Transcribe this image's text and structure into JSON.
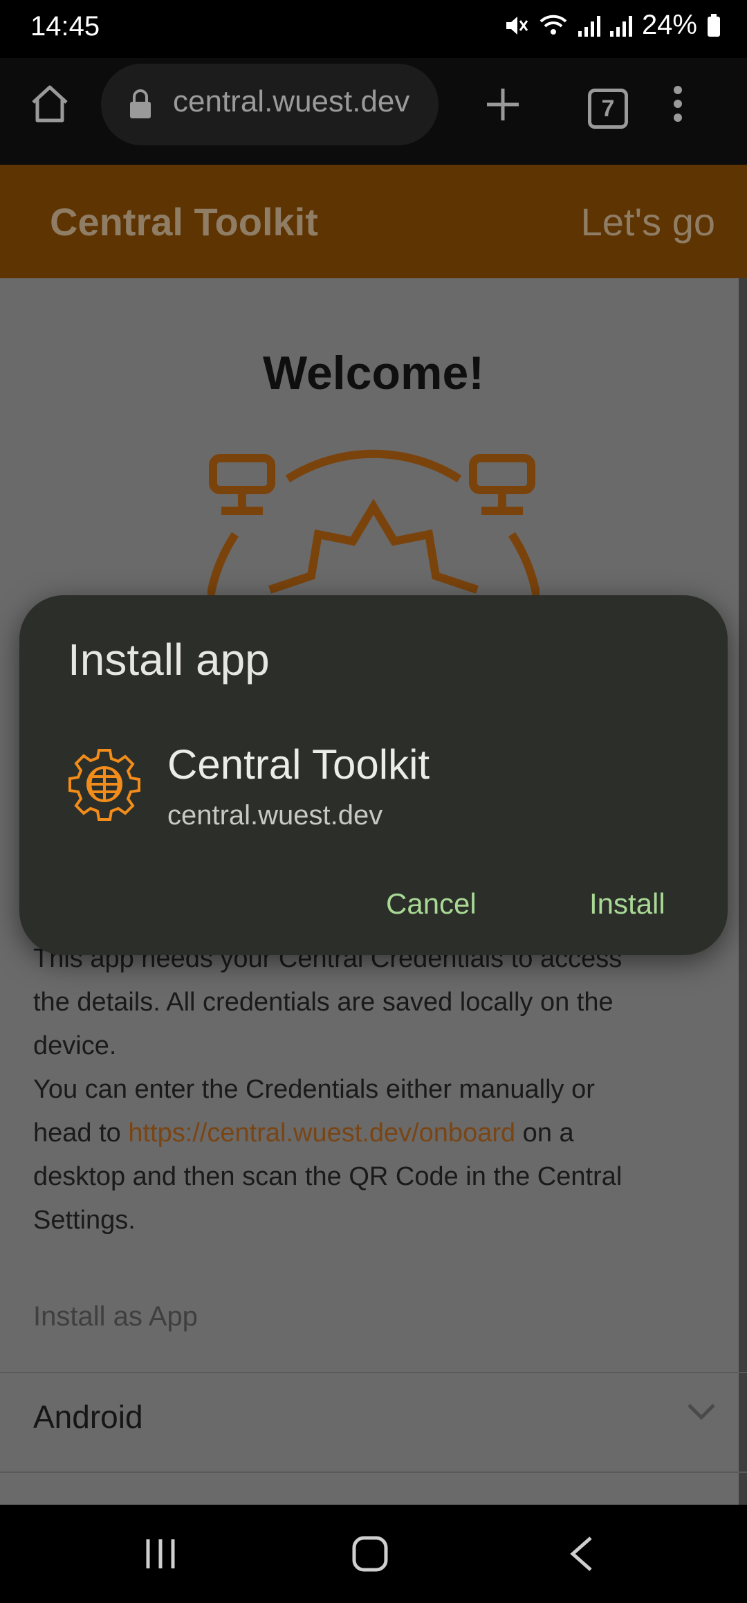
{
  "status_bar": {
    "time": "14:45",
    "battery": "24%"
  },
  "browser": {
    "url": "central.wuest.dev",
    "tab_count": "7"
  },
  "app_header": {
    "title": "Central Toolkit",
    "action": "Let's go"
  },
  "page": {
    "welcome": "Welcome!",
    "body_lines": [
      "This app needs your Central Credentials to access",
      "the details. All credentials are saved locally on the",
      "device."
    ],
    "body_p2_a": "You can enter the Credentials either manually or",
    "body_p2_b": "head to ",
    "body_link": "https://central.wuest.dev/onboard",
    "body_p2_c": " on a",
    "body_p2_d": "desktop and then scan the QR Code in the Central",
    "body_p2_e": "Settings.",
    "install_heading": "Install as App",
    "android_label": "Android"
  },
  "dialog": {
    "title": "Install app",
    "app_name": "Central Toolkit",
    "app_url": "central.wuest.dev",
    "cancel_label": "Cancel",
    "install_label": "Install"
  },
  "colors": {
    "accent": "#f28c1a",
    "dialog_bg": "#2b2e29",
    "button_text": "#a9d995"
  },
  "icons": [
    "home-icon",
    "lock-icon",
    "new-tab-icon",
    "tabs-icon",
    "more-icon",
    "gear-globe-icon",
    "chevron-down-icon",
    "recents-icon",
    "home-nav-icon",
    "back-icon"
  ]
}
